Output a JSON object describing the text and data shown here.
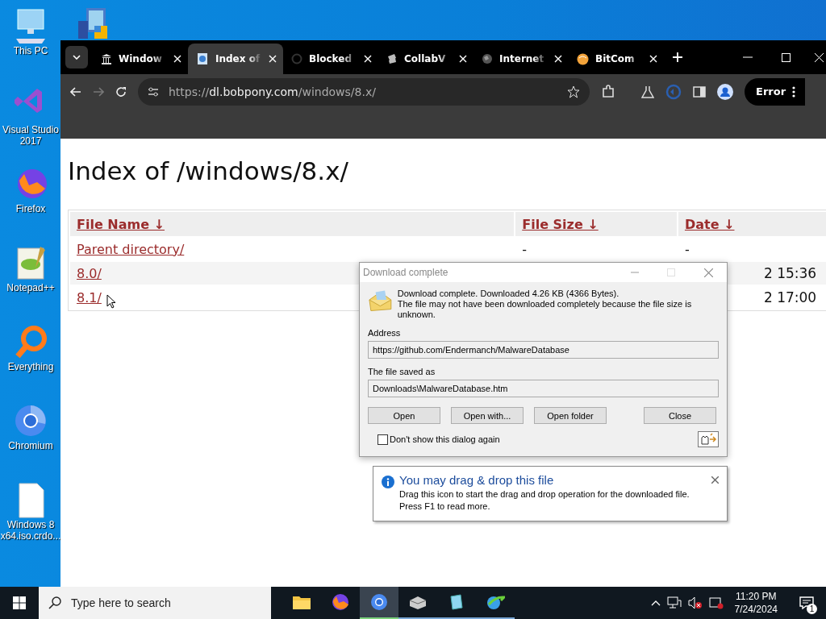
{
  "desktop": {
    "icons": [
      {
        "label": "This PC"
      },
      {
        "label": "Visual Studio 2017"
      },
      {
        "label": "Firefox"
      },
      {
        "label": "Notepad++"
      },
      {
        "label": "Everything"
      },
      {
        "label": "Chromium"
      },
      {
        "label": "Windows 8 x64.iso.crdo..."
      }
    ]
  },
  "browser": {
    "tabs": [
      {
        "title": "Window",
        "selected": false
      },
      {
        "title": "Index of",
        "selected": true
      },
      {
        "title": "Blocked",
        "selected": false
      },
      {
        "title": "CollabV",
        "selected": false
      },
      {
        "title": "Internet",
        "selected": false
      },
      {
        "title": "BitCom",
        "selected": false
      }
    ],
    "address": {
      "scheme": "https://",
      "host": "dl.bobpony.com",
      "path": "/windows/8.x/"
    },
    "profile_button": "Error"
  },
  "page": {
    "heading": "Index of /windows/8.x/",
    "columns": [
      "File Name ↓",
      "File Size ↓",
      "Date ↓"
    ],
    "rows": [
      {
        "name": "Parent directory/",
        "size": "-",
        "date": "-"
      },
      {
        "name": "8.0/",
        "date": "2 15:36"
      },
      {
        "name": "8.1/",
        "date": "2 17:00"
      }
    ]
  },
  "dialog": {
    "title": "Download complete",
    "message": [
      "Download complete. Downloaded 4.26  KB (4366 Bytes).",
      "The file may not have been downloaded completely because the file size is unknown."
    ],
    "address_label": "Address",
    "address_value": "https://github.com/Endermanch/MalwareDatabase",
    "saved_label": "The file saved as",
    "saved_value": "Downloads\\MalwareDatabase.htm",
    "buttons": [
      "Open",
      "Open with...",
      "Open folder",
      "Close"
    ],
    "checkbox": {
      "label": "Don't show this dialog again",
      "checked": false
    }
  },
  "tooltip": {
    "title": "You may drag & drop this file",
    "text": "Drag this icon to start the drag and drop operation for the downloaded file. Press F1 to read more."
  },
  "taskbar": {
    "search_placeholder": "Type here to search",
    "apps": [
      {
        "selected": false,
        "running": false
      },
      {
        "selected": false,
        "running": false
      },
      {
        "selected": true,
        "running": true
      },
      {
        "selected": false,
        "running": true
      },
      {
        "selected": false,
        "running": true
      },
      {
        "selected": false,
        "running": true
      }
    ],
    "time": "11:20 PM",
    "date": "7/24/2024",
    "notifications": "1"
  }
}
